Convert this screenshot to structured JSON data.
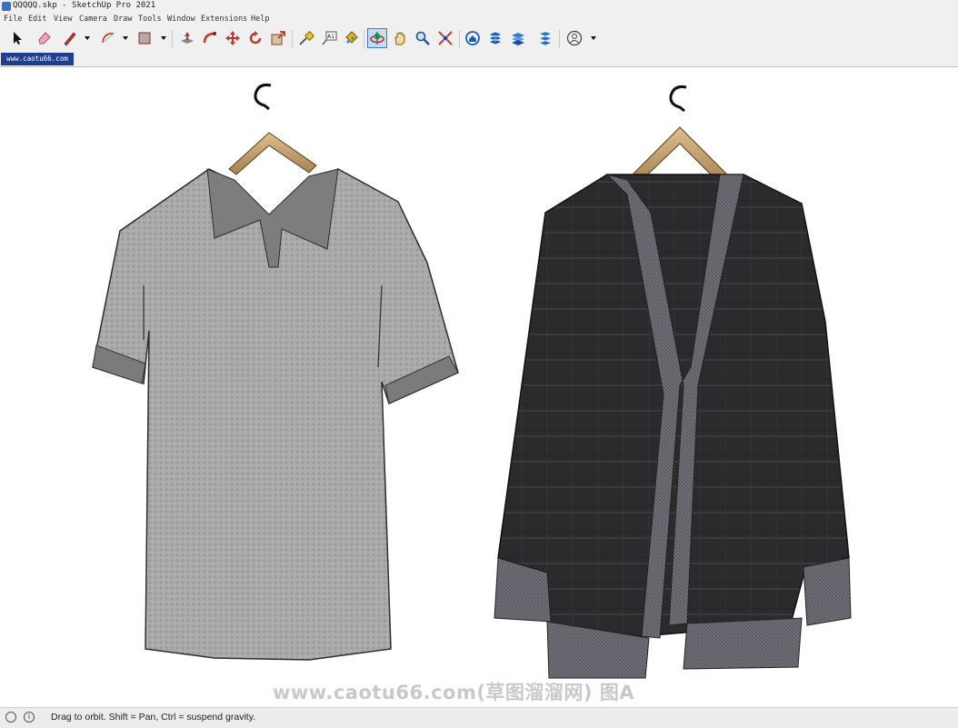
{
  "window": {
    "title": "QQQQQ.skp - SketchUp Pro 2021"
  },
  "menu": [
    "File",
    "Edit",
    "View",
    "Camera",
    "Draw",
    "Tools",
    "Window",
    "Extensions",
    "Help"
  ],
  "toolbar": {
    "tools": [
      "select-icon",
      "eraser-icon",
      "pencil-line-icon",
      "arc-icon",
      "rectangle-icon",
      "push-pull-icon",
      "follow-me-icon",
      "move-icon",
      "rotate-icon",
      "scale-icon",
      "tape-measure-icon",
      "text-icon",
      "paint-bucket-icon",
      "orbit-icon",
      "pan-icon",
      "zoom-icon",
      "zoom-extents-icon",
      "warehouse-icon",
      "extension-warehouse-icon",
      "layout-icon",
      "extension-manager-icon",
      "account-icon"
    ],
    "text_tool_label": "A1",
    "active_tool": "orbit-icon"
  },
  "scene_tab": {
    "label": "www.caotu66.com"
  },
  "viewport": {
    "watermark": "www.caotu66.com(草图溜溜网) 图A",
    "background": "#ffffff"
  },
  "status": {
    "text": "Drag to orbit. Shift = Pan, Ctrl = suspend gravity."
  },
  "colors": {
    "scene_tab": "#1e3f8f",
    "polo_body": "#a9a9a9",
    "polo_collar": "#7d7d7d",
    "cardigan_body": "#2a2a2a",
    "cardigan_trim": "#5e5e66",
    "hanger_wood": "#c9a274"
  }
}
